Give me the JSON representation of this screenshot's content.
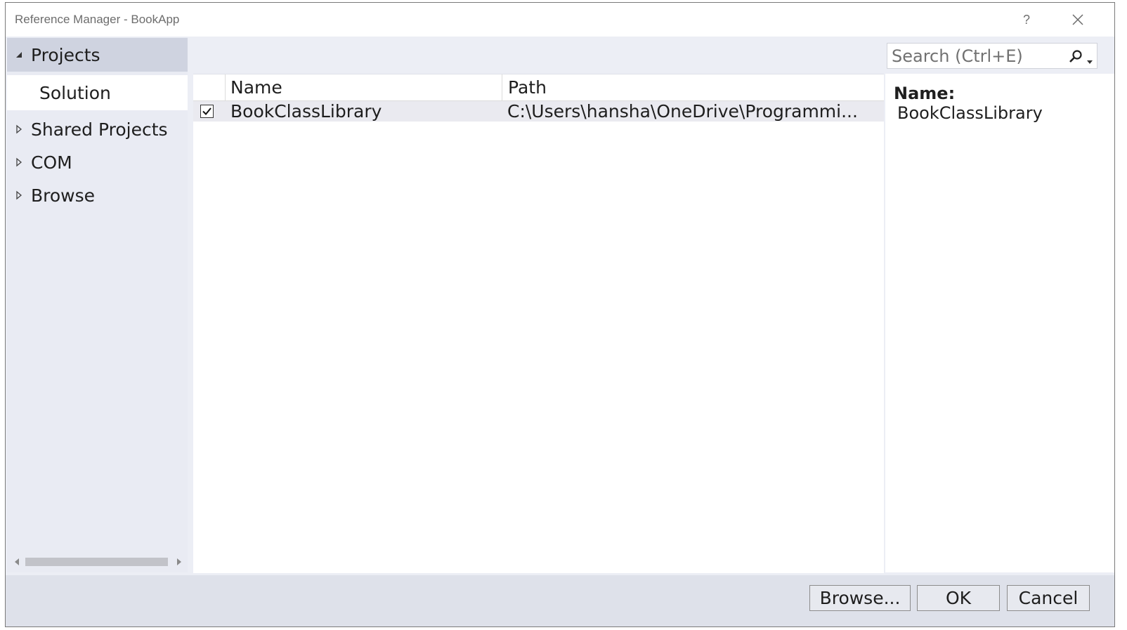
{
  "window": {
    "title": "Reference Manager - BookApp",
    "help_label": "?"
  },
  "nav": {
    "items": [
      {
        "label": "Projects",
        "expanded": true,
        "selected": true
      },
      {
        "label": "Solution",
        "child": true,
        "active": true
      },
      {
        "label": "Shared Projects",
        "expanded": false
      },
      {
        "label": "COM",
        "expanded": false
      },
      {
        "label": "Browse",
        "expanded": false
      }
    ]
  },
  "search": {
    "placeholder": "Search (Ctrl+E)"
  },
  "grid": {
    "columns": [
      "Name",
      "Path"
    ],
    "rows": [
      {
        "checked": true,
        "name": "BookClassLibrary",
        "path": "C:\\Users\\hansha\\OneDrive\\Programmi..."
      }
    ]
  },
  "details": {
    "name_label": "Name:",
    "name_value": "BookClassLibrary"
  },
  "footer": {
    "browse_label": "Browse...",
    "ok_label": "OK",
    "cancel_label": "Cancel"
  },
  "colors": {
    "nav_background": "#e9ebf3",
    "nav_selected": "#cfd3e0",
    "footer_background": "#dee1ea",
    "row_background": "#eaeaf0"
  },
  "icons": [
    "close-icon",
    "expanded-triangle-icon",
    "collapsed-triangle-icon",
    "search-icon",
    "dropdown-arrow-icon",
    "checkmark-icon"
  ]
}
